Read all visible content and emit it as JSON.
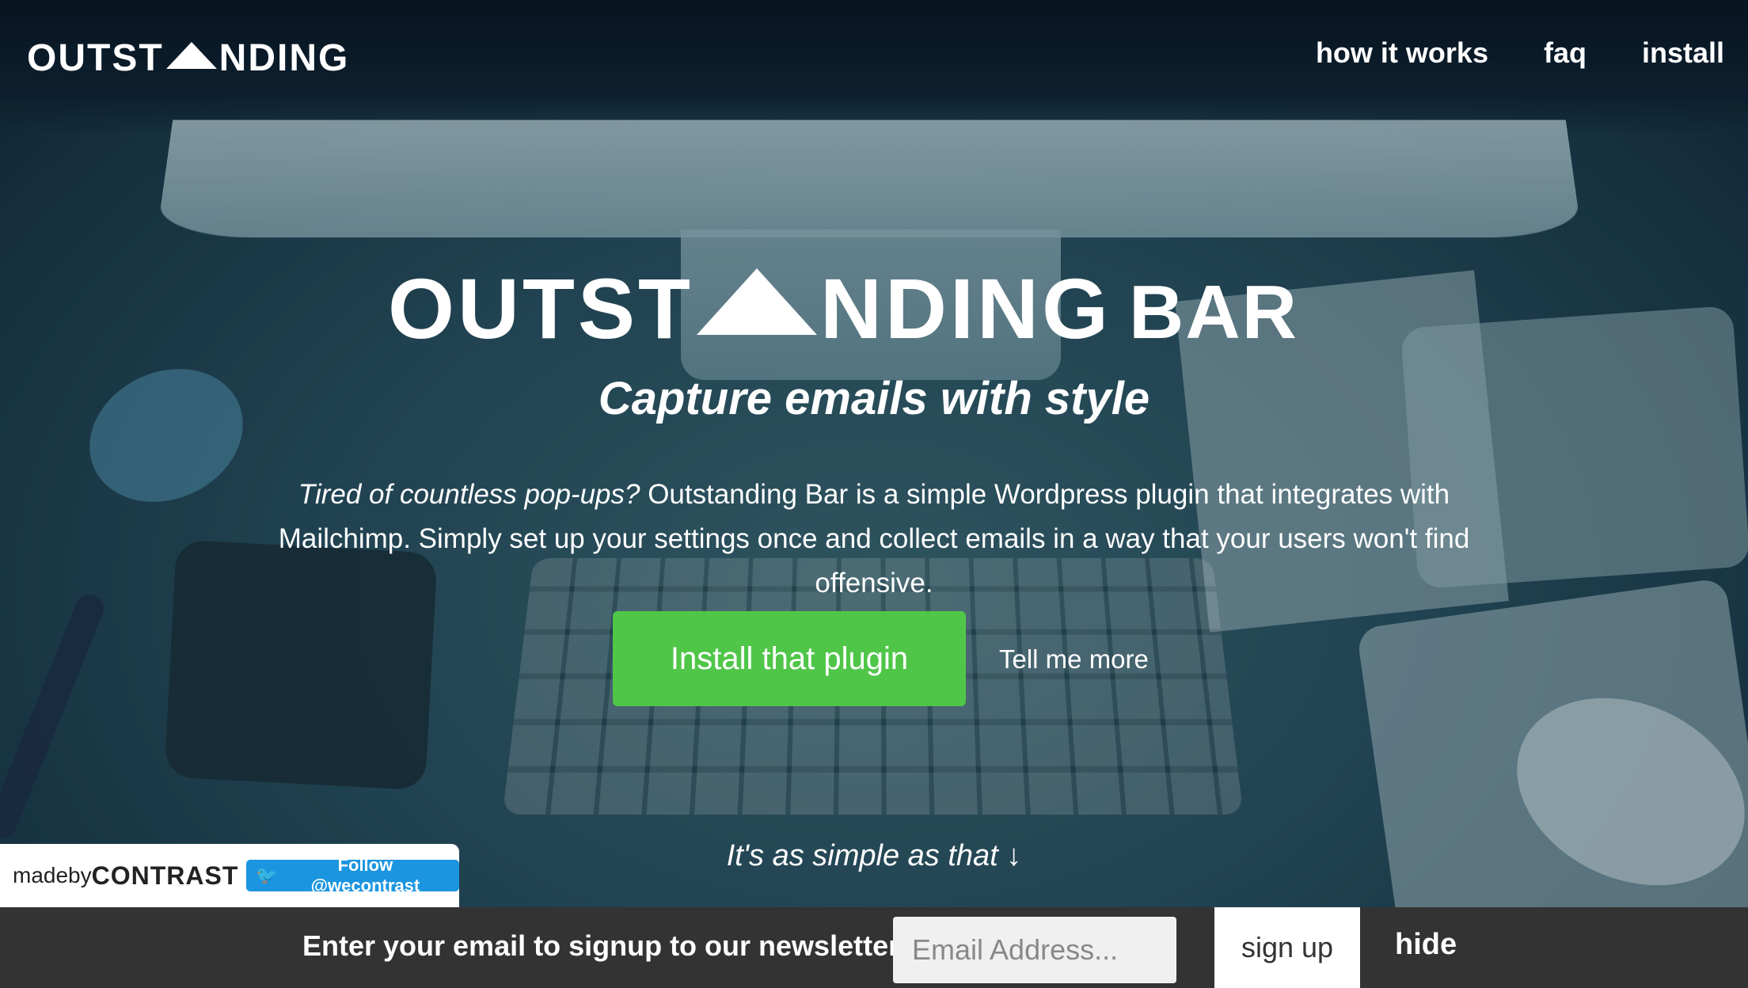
{
  "header": {
    "logo_left": "OUTST",
    "logo_right": "NDING",
    "nav": [
      "how it works",
      "faq",
      "install"
    ]
  },
  "hero": {
    "title_left": "OUTST",
    "title_right": "NDING",
    "title_suffix": "BAR",
    "tagline": "Capture emails with style",
    "description_italic": "Tired of countless pop-ups?",
    "description_rest": " Outstanding Bar is a simple Wordpress plugin that integrates with Mailchimp. Simply set up your settings once and collect emails in a way that your users won't find offensive.",
    "cta_label": "Install that plugin",
    "more_label": "Tell me more",
    "simple_text": "It's as simple as that ↓"
  },
  "badge": {
    "madeby": "madeby",
    "brand": "CONTRAST",
    "follow_label": "Follow @wecontrast"
  },
  "newsletter": {
    "label": "Enter your email to signup to our newsletter",
    "placeholder": "Email Address...",
    "signup_label": "sign up",
    "hide_label": "hide"
  },
  "colors": {
    "cta_green": "#50c649",
    "newsbar_bg": "#333333",
    "twitter_blue": "#1b95e0"
  }
}
